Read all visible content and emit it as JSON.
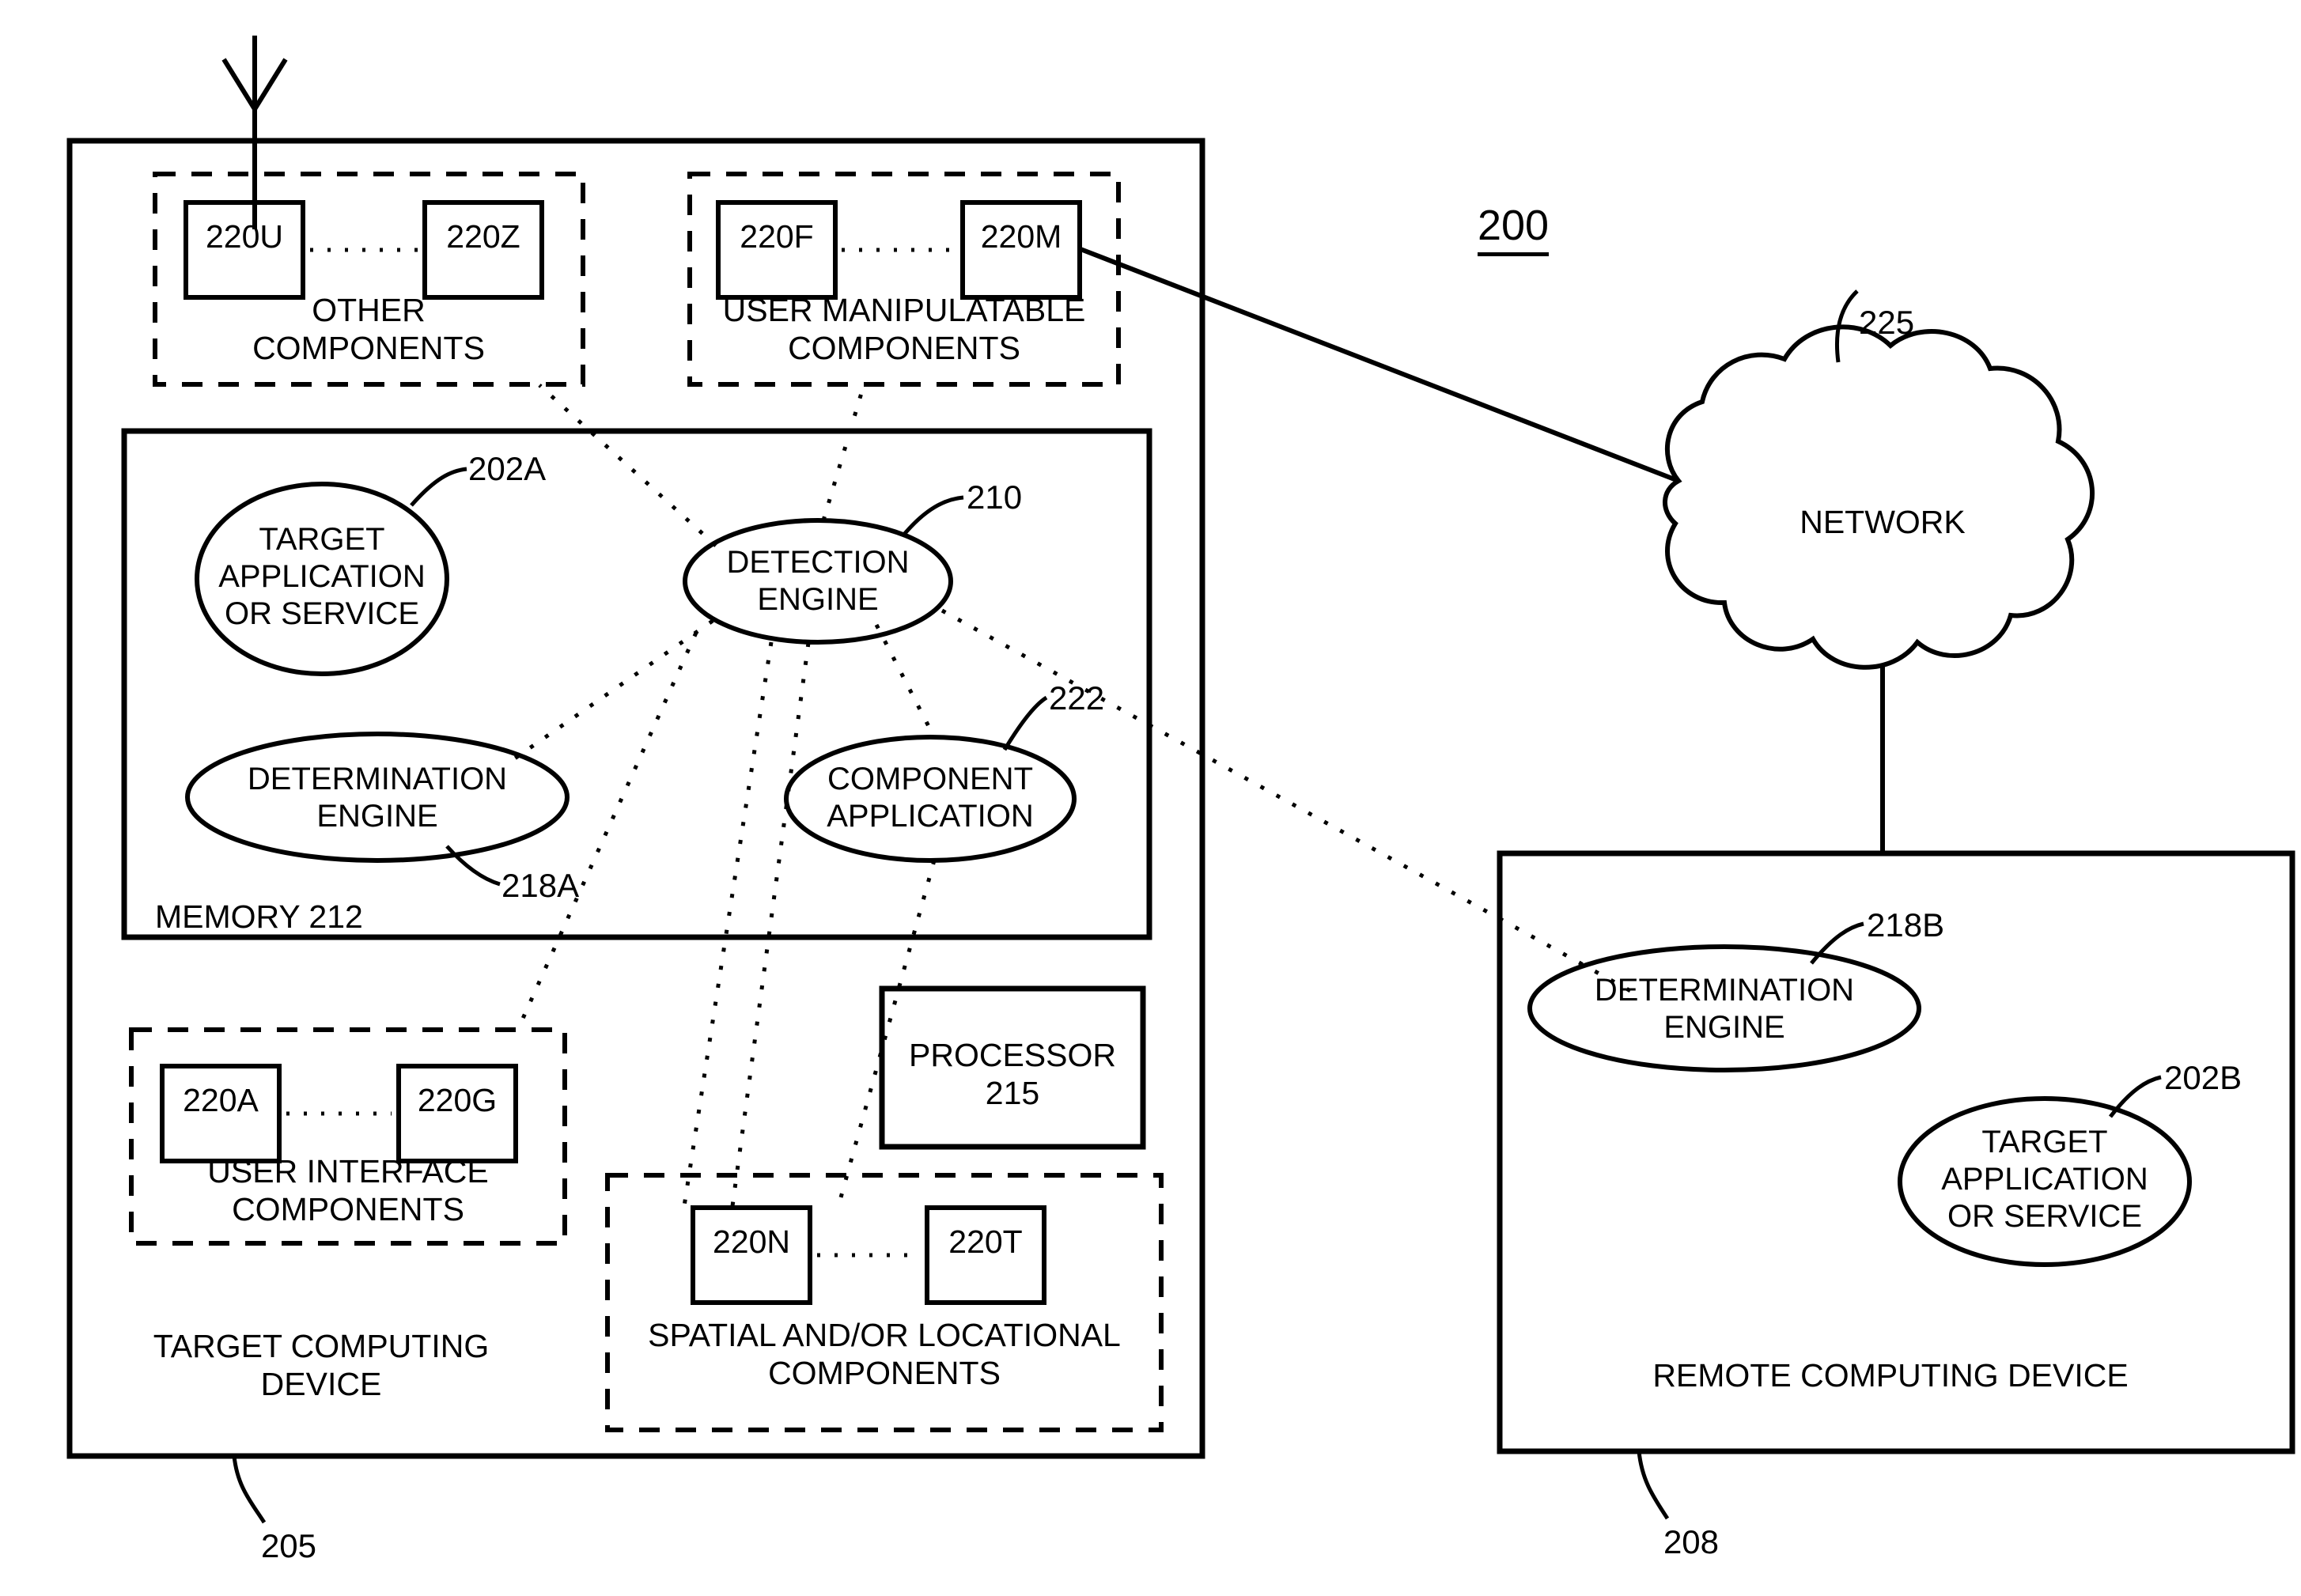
{
  "figure": {
    "number": "200"
  },
  "target_device": {
    "label": "TARGET COMPUTING\nDEVICE",
    "ref": "205",
    "antenna": "antenna-icon",
    "other_components": {
      "group_label": "OTHER\nCOMPONENTS",
      "boxes": [
        "220U",
        "220Z"
      ]
    },
    "user_manipulatable_components": {
      "group_label": "USER MANIPULATABLE\nCOMPONENTS",
      "boxes": [
        "220F",
        "220M"
      ]
    },
    "user_interface_components": {
      "group_label": "USER INTERFACE\nCOMPONENTS",
      "boxes": [
        "220A",
        "220G"
      ]
    },
    "spatial_locational_components": {
      "group_label": "SPATIAL AND/OR LOCATIONAL\nCOMPONENTS",
      "boxes": [
        "220N",
        "220T"
      ]
    },
    "memory": {
      "label": "MEMORY 212",
      "nodes": [
        {
          "label": "TARGET\nAPPLICATION\nOR SERVICE",
          "ref": "202A",
          "shape": "circle"
        },
        {
          "label": "DETECTION\nENGINE",
          "ref": "210",
          "shape": "ellipse"
        },
        {
          "label": "DETERMINATION\nENGINE",
          "ref": "218A",
          "shape": "ellipse"
        },
        {
          "label": "COMPONENT\nAPPLICATION",
          "ref": "222",
          "shape": "ellipse"
        }
      ]
    },
    "processor": {
      "label": "PROCESSOR\n215"
    }
  },
  "network": {
    "label": "NETWORK",
    "ref": "225"
  },
  "remote_device": {
    "label": "REMOTE COMPUTING DEVICE",
    "ref": "208",
    "nodes": [
      {
        "label": "DETERMINATION\nENGINE",
        "ref": "218B",
        "shape": "ellipse"
      },
      {
        "label": "TARGET\nAPPLICATION\nOR SERVICE",
        "ref": "202B",
        "shape": "circle"
      }
    ]
  },
  "colors": {
    "stroke": "#000000",
    "background": "#ffffff"
  }
}
